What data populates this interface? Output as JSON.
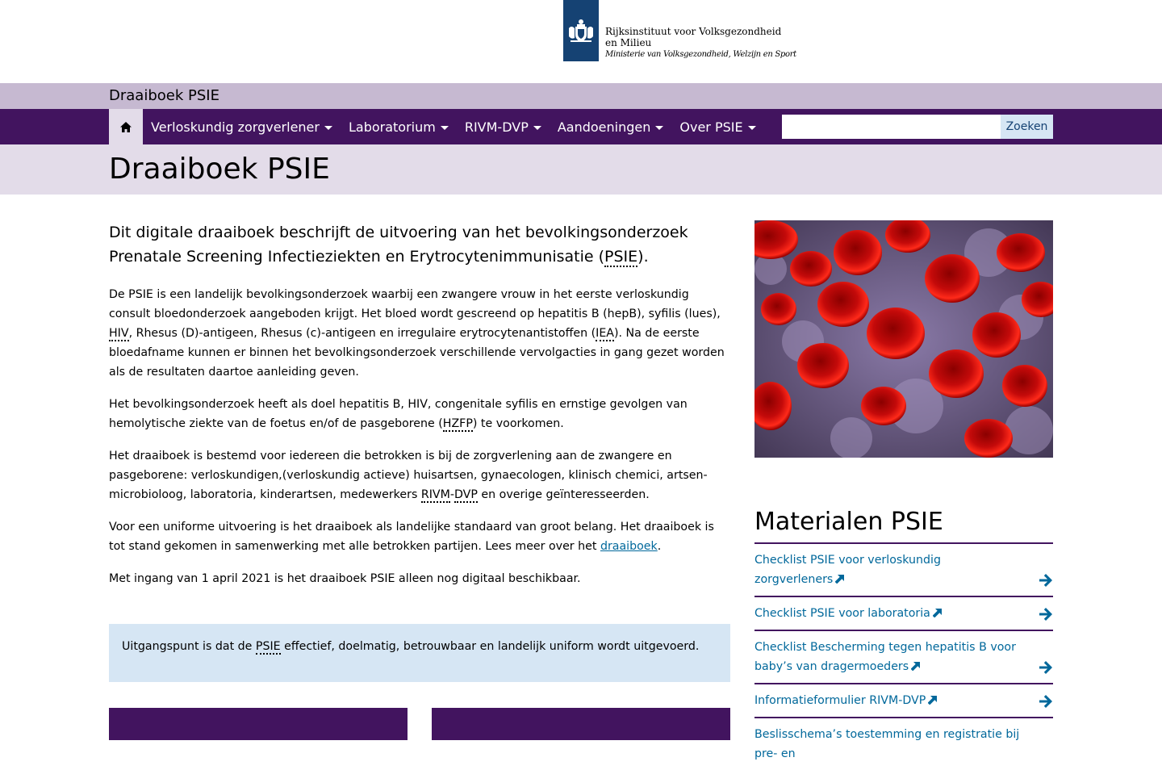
{
  "header": {
    "org_name": "Rijksinstituut voor Volksgezondheid en Milieu",
    "ministry": "Ministerie van Volksgezondheid, Welzijn en Sport",
    "logo_color": "#154273"
  },
  "site": {
    "name": "Draaiboek PSIE"
  },
  "nav": {
    "home_icon": "home-icon",
    "items": [
      {
        "label": "Verloskundig zorgverlener"
      },
      {
        "label": "Laboratorium"
      },
      {
        "label": "RIVM-DVP"
      },
      {
        "label": "Aandoeningen"
      },
      {
        "label": "Over PSIE"
      }
    ],
    "search": {
      "value": "",
      "button_label": "Zoeken"
    }
  },
  "page": {
    "title": "Draaiboek PSIE",
    "lead_text": "Dit digitale draaiboek beschrijft de uitvoering van het bevolkingsonderzoek Prenatale Screening Infectieziekten en Erytrocytenimmunisatie (",
    "lead_abbr": "PSIE",
    "lead_end": ").",
    "p1_a": "De PSIE is een landelijk bevolkingsonderzoek waarbij een zwangere vrouw in het eerste verloskundig consult bloedonderzoek aangeboden krijgt. Het bloed wordt gescreend op hepatitis B (hepB), syfilis (lues), ",
    "p1_abbr1": "HIV",
    "p1_b": ", Rhesus (D)-antigeen, Rhesus (c)-antigeen en irregulaire erytrocytenantistoffen (",
    "p1_abbr2": "IEA",
    "p1_c": "). Na de eerste bloedafname kunnen er binnen het bevolkingsonderzoek verschillende vervolgacties in gang gezet worden als de resultaten daartoe aanleiding geven.",
    "p2_a": "Het bevolkingsonderzoek heeft als doel hepatitis B, HIV, congenitale syfilis en ernstige gevolgen van hemolytische ziekte van de foetus en/of de pasgeborene (",
    "p2_abbr": "HZFP",
    "p2_b": ") te voorkomen.",
    "p3_a": "Het draaiboek is bestemd voor iedereen die betrokken is bij de zorgverlening aan de zwangere en pasgeborene: verloskundigen,(verloskundig actieve) huisartsen, gynaecologen, klinisch chemici, artsen-microbioloog, laboratoria, kinderartsen, medewerkers ",
    "p3_abbr1": "RIVM",
    "p3_sep": "-",
    "p3_abbr2": "DVP",
    "p3_b": " en overige geïnteresseerden.",
    "p4_a": "Voor een uniforme uitvoering is het draaiboek als landelijke standaard van groot belang. Het draaiboek is tot stand gekomen in samenwerking met alle betrokken partijen. Lees meer over het ",
    "p4_link": "draaiboek",
    "p4_b": ".",
    "p5": "Met ingang van 1 april 2021 is het draaiboek PSIE alleen nog digitaal beschikbaar.",
    "callout_a": "Uitgangspunt is dat de ",
    "callout_abbr": "PSIE",
    "callout_b": " effectief, doelmatig, betrouwbaar en landelijk uniform wordt uitgevoerd."
  },
  "sidebar": {
    "materials_title": "Materialen PSIE",
    "items": [
      {
        "label": "Checklist PSIE voor verloskundig zorgverleners"
      },
      {
        "label": "Checklist PSIE voor laboratoria"
      },
      {
        "label": "Checklist Bescherming tegen hepatitis B voor baby’s van dragermoeders"
      },
      {
        "label": "Informatieformulier RIVM-DVP"
      },
      {
        "label": "Beslisschema’s toestemming en registratie bij pre- en"
      }
    ]
  },
  "colors": {
    "primary_purple": "#42145f",
    "light_purple": "#c6b9d1",
    "lighter_purple": "#e3dce9",
    "link_blue": "#01689b",
    "callout_blue": "#d6e6f4"
  }
}
